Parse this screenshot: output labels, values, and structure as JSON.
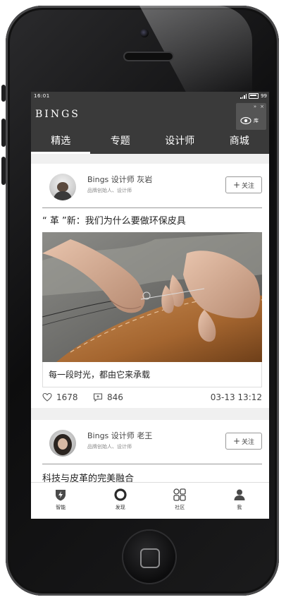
{
  "status_bar": {
    "time": "16:01",
    "battery": "99"
  },
  "header": {
    "brand": "BINGS",
    "widget": {
      "minimize": "»",
      "close": "×",
      "label": "库"
    },
    "tabs": [
      {
        "label": "精选",
        "active": true
      },
      {
        "label": "专题",
        "active": false
      },
      {
        "label": "设计师",
        "active": false
      },
      {
        "label": "商城",
        "active": false
      }
    ]
  },
  "feed": {
    "posts": [
      {
        "author": "Bings 设计师 灰岩",
        "author_subtitle": "品牌创始人、设计师",
        "follow_label": "关注",
        "title": "“ 革 ”新：我们为什么要做环保皮具",
        "caption": "每一段时光，都由它来承载",
        "likes": "1678",
        "comments": "846",
        "date": "03-13 13:12"
      },
      {
        "author": "Bings 设计师 老王",
        "author_subtitle": "品牌创始人、设计师",
        "follow_label": "关注",
        "title": "科技与皮革的完美融合"
      }
    ]
  },
  "bottom_nav": [
    {
      "label": "智能",
      "icon": "shield-bolt-icon"
    },
    {
      "label": "发现",
      "icon": "discover-ring-icon"
    },
    {
      "label": "社区",
      "icon": "community-grid-icon"
    },
    {
      "label": "我",
      "icon": "user-icon"
    }
  ],
  "colors": {
    "header_bg": "#3a3a3a",
    "screen_bg": "#f0f0f0",
    "card_bg": "#ffffff",
    "text_primary": "#222222",
    "text_secondary": "#888888"
  }
}
